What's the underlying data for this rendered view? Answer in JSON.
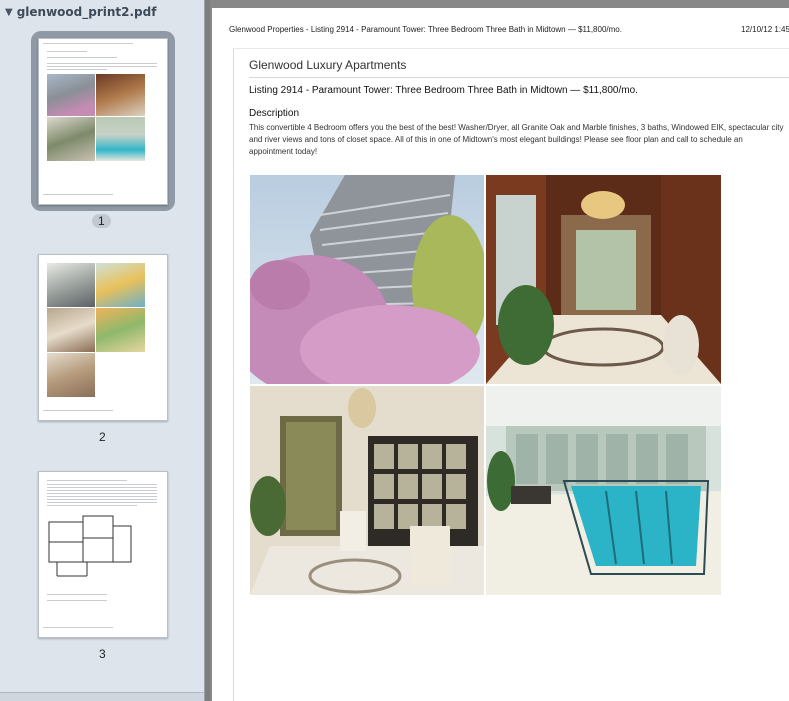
{
  "sidebar": {
    "file_name": "glenwood_print2.pdf",
    "pages": [
      {
        "label": "1"
      },
      {
        "label": "2"
      },
      {
        "label": "3"
      }
    ]
  },
  "document": {
    "print_header": "Glenwood Properties - Listing 2914 - Paramount Tower: Three Bedroom Three Bath in Midtown — $11,800/mo.",
    "print_date": "12/10/12 1:45",
    "site_title": "Glenwood Luxury Apartments",
    "listing_title": "Listing 2914 - Paramount Tower: Three Bedroom Three Bath in Midtown — $11,800/mo.",
    "description_heading": "Description",
    "description_text": "This convertible 4 Bedroom offers you the best of the best! Washer/Dryer, all Granite Oak and Marble finishes, 3 baths, Windowed EIK, spectacular city and river views and tons of closet space. All of this in one of Midtown's most elegant buildings! Please see floor plan and call to schedule an appointment today!"
  },
  "colors": {
    "sidebar_bg": "#dee4ec",
    "selection": "#8f9aa6",
    "pool_water": "#2bb3c8"
  }
}
